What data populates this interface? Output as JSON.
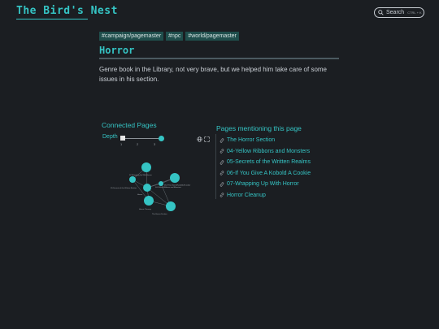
{
  "header": {
    "site_title": "The Bird's Nest",
    "search": {
      "label": "Search",
      "shortcut": "CTRL + K",
      "icon": "search-icon"
    }
  },
  "tags": [
    "#campaign/pagemaster",
    "#npc",
    "#world/pagemaster"
  ],
  "page": {
    "title": "Horror",
    "description": "Genre book in the Library, not very brave, but we helped him take care of some issues in his section."
  },
  "graph": {
    "heading": "Connected Pages",
    "depth_label": "Depth",
    "depth_ticks": [
      "1",
      "2",
      "3"
    ],
    "depth_value": 3,
    "icons": [
      "globe-icon",
      "expand-icon"
    ],
    "node_labels": [
      "07-Wrapping Up With Horror",
      "06-If You Give A Kobold A Cookie",
      "05-Secrets of the Written Realms",
      "Horror",
      "04-Yellow Ribbons and Monsters",
      "Horror Cleanup",
      "The Horror Section"
    ]
  },
  "mentions": {
    "heading": "Pages mentioning this page",
    "icon": "link-icon",
    "items": [
      "The Horror Section",
      "04-Yellow Ribbons and Monsters",
      "05-Secrets of the Written Realms",
      "06-If You Give A Kobold A Cookie",
      "07-Wrapping Up With Horror",
      "Horror Cleanup"
    ]
  },
  "colors": {
    "accent": "#35c4c4",
    "background": "#1b1e22",
    "tag_bg": "#1f4e4c"
  }
}
